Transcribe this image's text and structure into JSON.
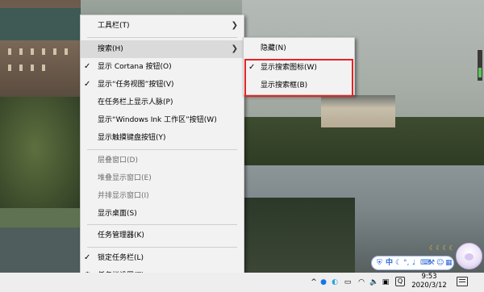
{
  "context_menu": {
    "items": [
      {
        "label": "工具栏(T)",
        "submenu": true,
        "checked": false,
        "disabled": false
      },
      {
        "label": "搜索(H)",
        "submenu": true,
        "checked": false,
        "disabled": false,
        "hover": true
      },
      {
        "label": "显示 Cortana 按钮(O)",
        "checked": true,
        "disabled": false
      },
      {
        "label": "显示“任务视图”按钮(V)",
        "checked": true,
        "disabled": false
      },
      {
        "label": "在任务栏上显示人脉(P)",
        "checked": false,
        "disabled": false
      },
      {
        "label": "显示“Windows Ink 工作区”按钮(W)",
        "checked": false,
        "disabled": false
      },
      {
        "label": "显示触摸键盘按钮(Y)",
        "checked": false,
        "disabled": false
      },
      {
        "label": "层叠窗口(D)",
        "checked": false,
        "disabled": true
      },
      {
        "label": "堆叠显示窗口(E)",
        "checked": false,
        "disabled": true
      },
      {
        "label": "并排显示窗口(I)",
        "checked": false,
        "disabled": true
      },
      {
        "label": "显示桌面(S)",
        "checked": false,
        "disabled": false
      },
      {
        "label": "任务管理器(K)",
        "checked": false,
        "disabled": false
      },
      {
        "label": "锁定任务栏(L)",
        "checked": true,
        "disabled": false
      },
      {
        "label": "任务栏设置(T)",
        "checked": false,
        "disabled": false,
        "icon": "gear-icon"
      }
    ]
  },
  "search_submenu": {
    "items": [
      {
        "label": "隐藏(N)",
        "checked": false
      },
      {
        "label": "显示搜索图标(W)",
        "checked": true
      },
      {
        "label": "显示搜索框(B)",
        "checked": false
      }
    ],
    "highlight_color": "#e62323"
  },
  "taskbar": {
    "time": "9:53",
    "date": "2020/3/12",
    "tray_icons": [
      "chevron-up-icon",
      "bluetooth-icon",
      "network-icon",
      "battery-icon",
      "wifi-icon",
      "volume-icon",
      "ime-icon",
      "notification-icon"
    ],
    "ime_indicator": "Q",
    "chevron": "^"
  },
  "ime_toolbar": {
    "labels": [
      "中"
    ],
    "icons": [
      "shield-icon",
      "moon-icon",
      "comma-icon",
      "mic-icon",
      "keyboard-icon",
      "wrench-icon",
      "smile-icon",
      "grid-icon"
    ]
  }
}
